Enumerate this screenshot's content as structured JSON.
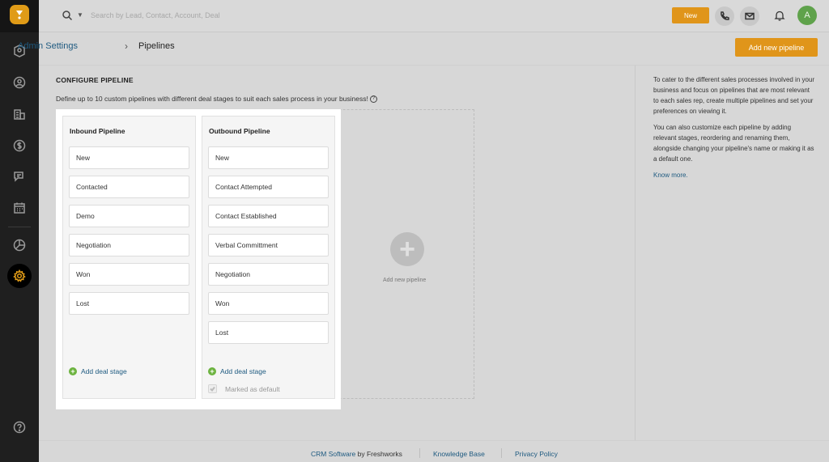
{
  "topbar": {
    "search_placeholder": "Search by Lead, Contact, Account, Deal",
    "new_button": "New",
    "avatar_initial": "A"
  },
  "breadcrumb": {
    "parent": "Admin Settings",
    "separator": "›",
    "current": "Pipelines"
  },
  "actions": {
    "add_new_pipeline": "Add new pipeline"
  },
  "configure": {
    "title": "CONFIGURE PIPELINE",
    "description": "Define up to 10 custom pipelines with different deal stages to suit each sales process in your business!"
  },
  "pipelines": [
    {
      "name": "Inbound Pipeline",
      "stages": [
        "New",
        "Contacted",
        "Demo",
        "Negotiation",
        "Won",
        "Lost"
      ],
      "add_stage_label": "Add deal stage"
    },
    {
      "name": "Outbound Pipeline",
      "stages": [
        "New",
        "Contact Attempted",
        "Contact Established",
        "Verbal Committment",
        "Negotiation",
        "Won",
        "Lost"
      ],
      "add_stage_label": "Add deal stage",
      "default_label": "Marked as default"
    }
  ],
  "placeholder": {
    "add_new_pipeline_label": "Add new pipeline"
  },
  "info": {
    "paragraph1": "To cater to the different sales processes involved in your business and focus on pipelines that are most relevant to each sales rep, create multiple pipelines and set your preferences on viewing it.",
    "paragraph2": "You can also customize each pipeline by adding relevant stages, reordering and renaming them, alongside changing your pipeline's name or making it as a default one.",
    "link": "Know more."
  },
  "footer": {
    "crm_link": "CRM Software",
    "crm_suffix": " by Freshworks",
    "knowledge_base": "Knowledge Base",
    "privacy_policy": "Privacy Policy"
  },
  "colors": {
    "accent": "#e0951a",
    "link": "#1e5a80",
    "add_green": "#6cb33f"
  },
  "icons": [
    "search-icon",
    "phone-icon",
    "mail-icon",
    "bell-icon",
    "contacts-icon",
    "user-icon",
    "building-icon",
    "dollar-icon",
    "chat-icon",
    "calendar-icon",
    "reports-icon",
    "gear-icon",
    "help-icon"
  ]
}
